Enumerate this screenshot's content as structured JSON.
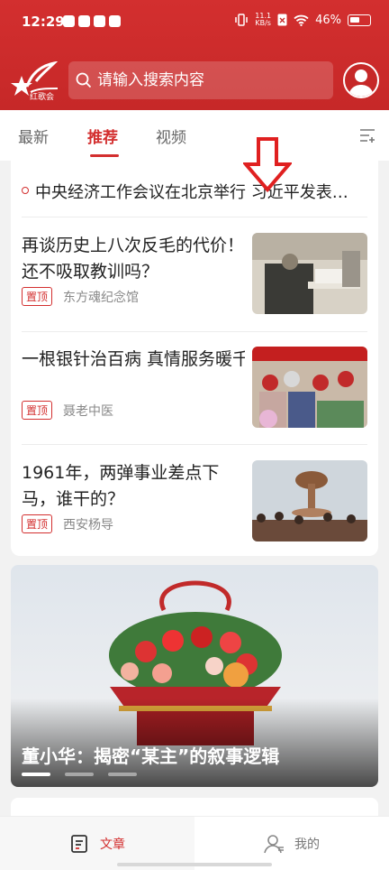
{
  "status_bar": {
    "time": "12:29",
    "network_speed": "11.1\nKB/s",
    "battery": "46%"
  },
  "header": {
    "logo_alt": "红歌会",
    "search_placeholder": "请输入搜索内容"
  },
  "tabs": {
    "items": [
      "最新",
      "推荐",
      "视频"
    ],
    "active": "推荐"
  },
  "headline": {
    "text": "中央经济工作会议在北京举行 习近平发表重要讲话"
  },
  "articles": [
    {
      "title": "再谈历史上八次反毛的代价！还不吸取教训吗？",
      "badge": "置顶",
      "source": "东方魂纪念馆"
    },
    {
      "title": "一根银针治百病 真情服务暖千家：聂晓萍老中医…",
      "badge": "置顶",
      "source": "聂老中医"
    },
    {
      "title": "1961年，两弹事业差点下马，谁干的？",
      "badge": "置顶",
      "source": "西安杨导"
    }
  ],
  "banner": {
    "caption": "董小华：揭密“某主”的叙事逻辑",
    "page_count": 3,
    "active_page": 1
  },
  "bottom_nav": {
    "items": [
      "文章",
      "我的"
    ],
    "active": "文章"
  },
  "colors": {
    "brand_red": "#d32f2f",
    "text_dark": "#222222",
    "text_muted": "#888888"
  }
}
